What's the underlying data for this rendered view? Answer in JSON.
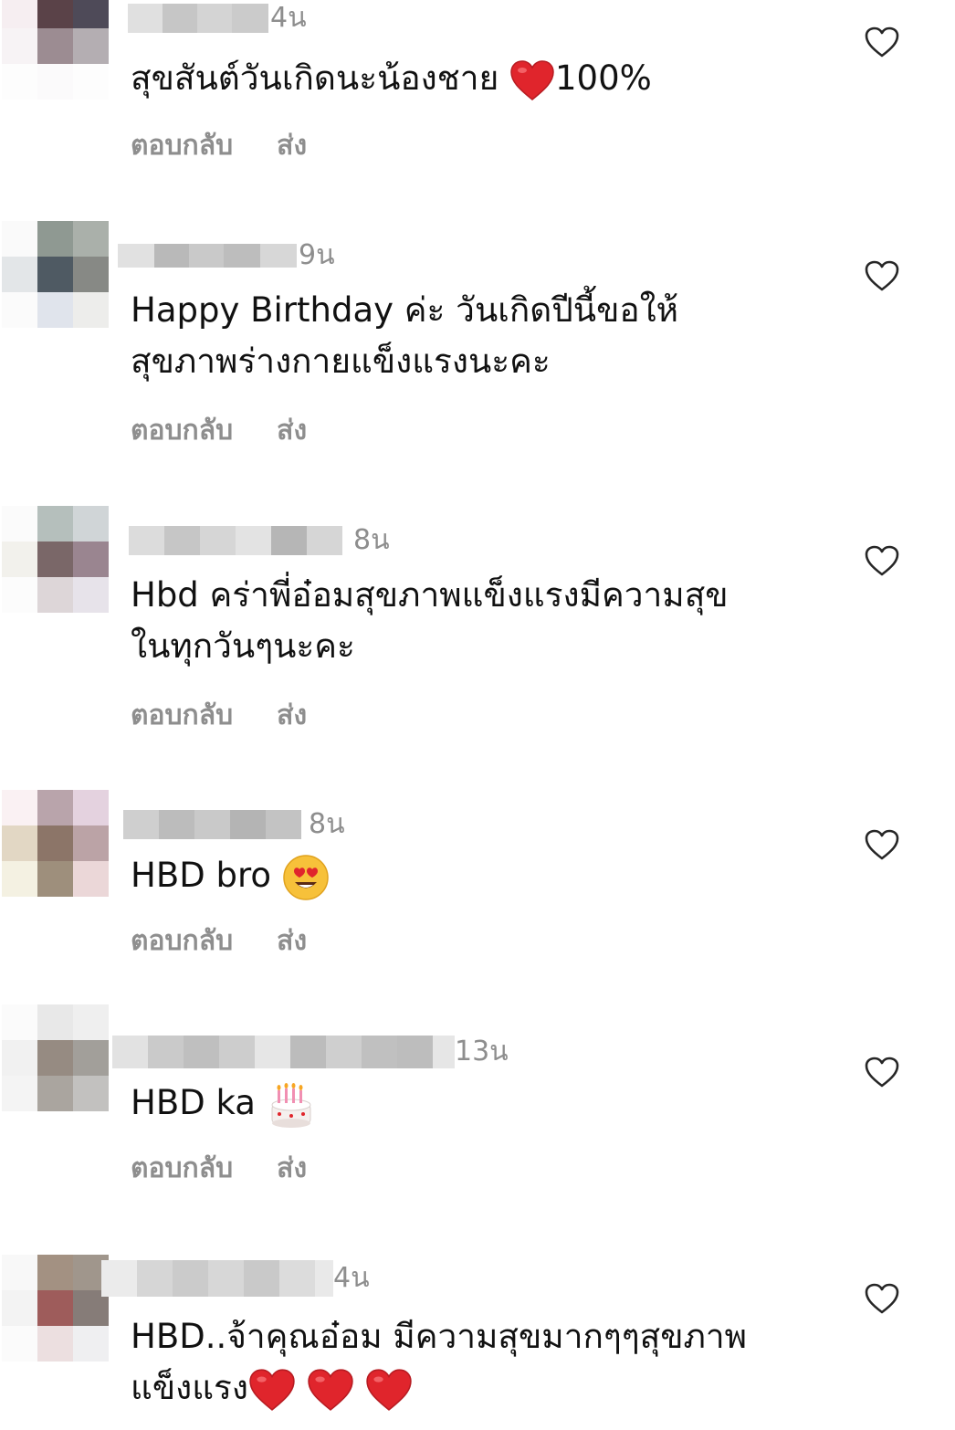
{
  "labels": {
    "reply": "ตอบกลับ",
    "send": "ส่ง"
  },
  "icons": {
    "like": "heart-outline-icon"
  },
  "comments": [
    {
      "time": "4น",
      "text_before": "สุขสันต์วันเกิดนะน้องชาย ",
      "emoji": "red-heart-icon",
      "text_after": "100%"
    },
    {
      "time": "9น",
      "text": "Happy Birthday ค่ะ วันเกิดปีนี้ขอให้\nสุขภาพร่างกายแข็งแรงนะคะ"
    },
    {
      "time": "8น",
      "text": "Hbd คร่าพี่อ๋อมสุขภาพแข็งแรงมีความสุข\nในทุกวันๆนะคะ"
    },
    {
      "time": "8น",
      "text_before": "HBD bro ",
      "emoji": "heart-eyes-face-icon"
    },
    {
      "time": "13น",
      "text_before": "HBD ka ",
      "emoji": "birthday-cake-icon"
    },
    {
      "time": "4น",
      "text_line1": "HBD..จ้าคุณอ๋อม มีความสุขมากๆๆสุขภาพ",
      "text_line2": "แข็งแรง",
      "emoji": "red-heart-icon"
    }
  ]
}
